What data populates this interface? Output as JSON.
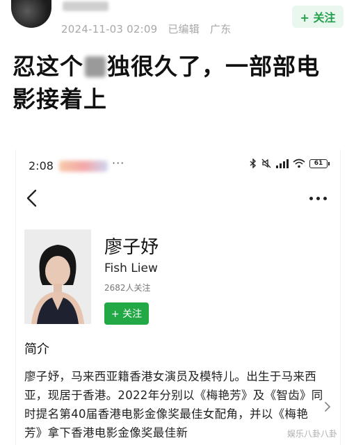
{
  "post": {
    "date": "2024-11-03 02:09",
    "edited": "已编辑",
    "location": "广东",
    "follow_label": "+ 关注",
    "title_before": "忍这个",
    "title_after": "独很久了，一部部电影接着上"
  },
  "screenshot": {
    "status": {
      "time": "2:08",
      "dots": "···",
      "battery": "61"
    },
    "profile": {
      "name": "廖子妤",
      "english_name": "Fish Liew",
      "followers": "2682人关注",
      "follow_label": "+ 关注"
    },
    "intro": {
      "heading": "简介",
      "text": "廖子妤，马来西亚籍香港女演员及模特儿。出生于马来西亚，现居于香港。2022年分别以《梅艳芳》及《智齿》同时提名第40届香港电影金像奖最佳女配角，并以《梅艳芳》拿下香港电影金像奖最佳新"
    },
    "watermark": "娱乐八卦八卦"
  },
  "colors": {
    "accent_green": "#23a846",
    "follow_top_bg": "#e9f7ee",
    "follow_top_text": "#22a04b",
    "meta_gray": "#a8a8a8"
  }
}
